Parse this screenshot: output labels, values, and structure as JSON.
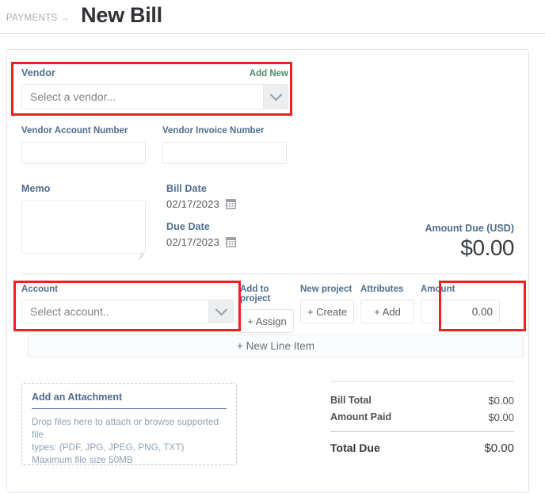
{
  "header": {
    "breadcrumb": "PAYMENTS",
    "breadcrumb_arrow": "→",
    "title": "New Bill"
  },
  "vendor": {
    "label": "Vendor",
    "add_new_label": "Add New",
    "placeholder": "Select a vendor...",
    "chevron_icon": "chevron-down-icon"
  },
  "vendor_account_number": {
    "label": "Vendor Account Number",
    "value": ""
  },
  "vendor_invoice_number": {
    "label": "Vendor Invoice Number",
    "value": ""
  },
  "memo": {
    "label": "Memo",
    "value": ""
  },
  "bill_date": {
    "label": "Bill Date",
    "value": "02/17/2023",
    "icon": "calendar-icon"
  },
  "due_date": {
    "label": "Due Date",
    "value": "02/17/2023",
    "icon": "calendar-icon"
  },
  "amount_due": {
    "label": "Amount Due (USD)",
    "value": "$0.00"
  },
  "line_item": {
    "account_label": "Account",
    "account_placeholder": "Select account..",
    "add_to_project_label": "Add to project",
    "assign_button": "+ Assign",
    "new_project_label": "New project",
    "create_button": "+ Create",
    "attributes_label": "Attributes",
    "add_button": "+ Add",
    "amount_label": "Amount",
    "amount_value": "0.00"
  },
  "new_line_item_button": "+ New Line Item",
  "attachment": {
    "title": "Add an Attachment",
    "description_line1": "Drop files here to attach or browse supported file",
    "description_line2": "types: (PDF, JPG, JPEG, PNG, TXT)",
    "description_line3": "Maximum file size 50MB"
  },
  "totals": {
    "bill_total_label": "Bill Total",
    "bill_total_value": "$0.00",
    "amount_paid_label": "Amount Paid",
    "amount_paid_value": "$0.00",
    "total_due_label": "Total Due",
    "total_due_value": "$0.00"
  },
  "colors": {
    "label_blue": "#4d6e8f",
    "link_green": "#4b8c6b",
    "highlight_red": "#ee2020",
    "title_dark": "#2f3337"
  }
}
